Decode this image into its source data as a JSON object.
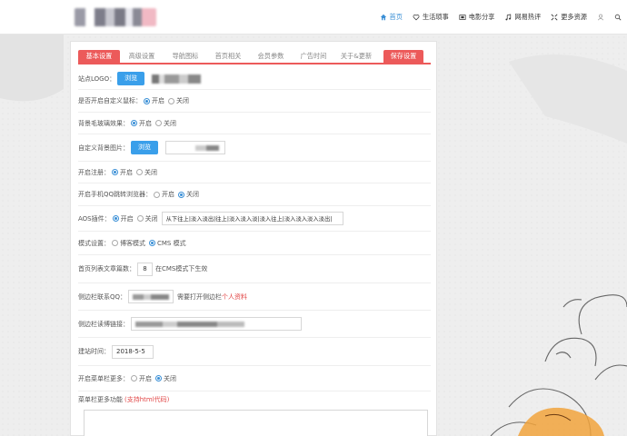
{
  "header": {
    "nav": [
      {
        "label": "首页",
        "icon": "home-icon",
        "active": true
      },
      {
        "label": "生活琐事",
        "icon": "heart-icon",
        "active": false
      },
      {
        "label": "电影分享",
        "icon": "film-icon",
        "active": false
      },
      {
        "label": "网易热评",
        "icon": "music-icon",
        "active": false
      },
      {
        "label": "更多资源",
        "icon": "expand-icon",
        "active": false
      }
    ]
  },
  "tabs": [
    "基本设置",
    "高级设置",
    "导航图标",
    "首页相关",
    "会员参数",
    "广告时间",
    "关于&更新",
    "保存设置"
  ],
  "settings": {
    "logo": {
      "label": "站点LOGO：",
      "button": "浏览"
    },
    "custom_cursor": {
      "label": "是否开启自定义鼠标：",
      "on": "开启",
      "off": "关闭"
    },
    "bg_blur": {
      "label": "背景毛玻璃效果：",
      "on": "开启",
      "off": "关闭"
    },
    "custom_bg": {
      "label": "自定义背景图片：",
      "button": "浏览"
    },
    "register": {
      "label": "开启注册：",
      "on": "开启",
      "off": "关闭"
    },
    "mobile_qq": {
      "label": "开启手机QQ跳转浏览器：",
      "on": "开启",
      "off": "关闭"
    },
    "aos": {
      "label": "AOS插件：",
      "on": "开启",
      "off": "关闭",
      "value": "从下往上|淡入淡出|往上|淡入淡入淡|淡入往上|淡入淡入淡入淡出|"
    },
    "mode": {
      "label": "模式设置：",
      "blog": "博客模式",
      "cms": "CMS 模式"
    },
    "home_count": {
      "label": "首页列表文章篇数：",
      "value": "8",
      "note": "在CMS模式下生效"
    },
    "sidebar_qq": {
      "label": "侧边栏联系QQ：",
      "note": "需要打开侧边栏",
      "link": "个人资料"
    },
    "sidebar_link": {
      "label": "侧边栏读博链接："
    },
    "site_date": {
      "label": "建站时间：",
      "value": "2018-5-5"
    },
    "menu_more": {
      "label": "开启菜单栏更多：",
      "on": "开启",
      "off": "关闭"
    },
    "menu_func": {
      "label": "菜单栏更多功能",
      "note": "(支持html代码)"
    }
  },
  "colors": {
    "accent_red": "#ec5a5a",
    "accent_blue": "#3a9fea",
    "link_blue": "#3a8fd6"
  }
}
